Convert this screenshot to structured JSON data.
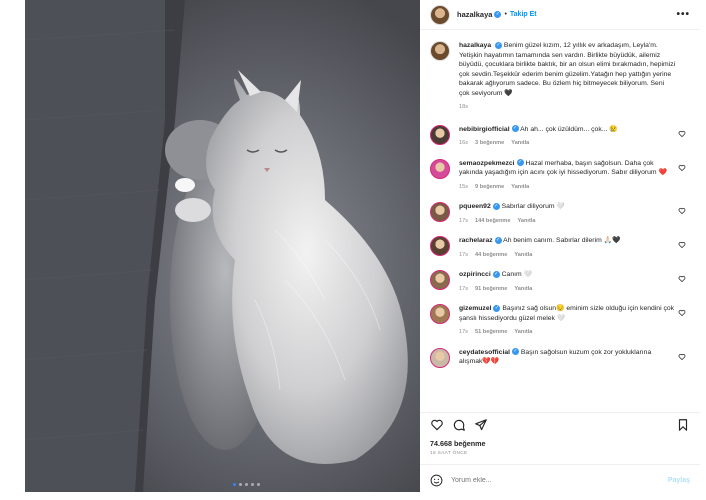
{
  "post": {
    "username": "hazalkaya",
    "follow_label": "Takip Et",
    "more_label": "•••",
    "caption": "Benim güzel kızım, 12 yıllık ev arkadaşım, Leyla'm. Yetişkin hayatımın tamamında sen vardın. Birlikte büyüdük, ailemiz büyüdü, çocuklara birlikte baktık, bir an olsun elimi bırakmadın, hepimizi çok sevdin.Teşekkür ederim benim güzelim.Yatağın hep yattığın yerine bakarak ağlıyorum sadece. Bu özlem hiç bitmeyecek biliyorum. Seni çok seviyorum 🖤",
    "caption_time": "18s"
  },
  "comments": [
    {
      "user": "nebibirgiofficial",
      "text": "Ah ah... çok üzüldüm... çok... 😢",
      "time": "16s",
      "likes": "3 beğenme",
      "reply": "Yanıtla",
      "avatar_color": "#4a3b35"
    },
    {
      "user": "semaozpekmezci",
      "text": "Hazal merhaba, başın sağolsun. Daha çok yakında yaşadığım için acını çok iyi hissediyorum. Sabır diliyorum ❤️",
      "time": "15s",
      "likes": "9 beğenme",
      "reply": "Yanıtla",
      "avatar_color": "#d64a9b"
    },
    {
      "user": "pqueen92",
      "text": "Sabırlar diliyorum 🤍",
      "time": "17s",
      "likes": "144 beğenme",
      "reply": "Yanıtla",
      "avatar_color": "#7a5a44"
    },
    {
      "user": "rachelaraz",
      "text": "Ah benim canım. Sabırlar dilerim 🙏🏻🖤",
      "time": "17s",
      "likes": "44 beğenme",
      "reply": "Yanıtla",
      "avatar_color": "#5b3f33"
    },
    {
      "user": "ozpirincci",
      "text": "Canım 🤍",
      "time": "17s",
      "likes": "91 beğenme",
      "reply": "Yanıtla",
      "avatar_color": "#8a6a4c"
    },
    {
      "user": "gizemuzel",
      "text": "Başınız sağ olsun😔 eminim sizle olduğu için kendini çok şanslı hissediyordu güzel melek 🤍",
      "time": "17s",
      "likes": "51 beğenme",
      "reply": "Yanıtla",
      "avatar_color": "#a07853"
    },
    {
      "user": "ceydatesofficial",
      "text": "Başın sağolsun kuzum çok zor yokluklarına alışmak💔💔",
      "time": "",
      "likes": "",
      "reply": "",
      "avatar_color": "#c9b9a8"
    }
  ],
  "footer": {
    "likes_count": "74.668 beğenme",
    "time_ago": "18 SAAT ÖNCE",
    "comment_placeholder": "Yorum ekle...",
    "post_label": "Paylaş"
  },
  "carousel": {
    "slides": 5,
    "active": 0
  },
  "colors": {
    "link": "#0095f6",
    "verified": "#3897f0",
    "muted": "#8e8e8e",
    "dot_active": "#3b82f6"
  },
  "icons": [
    "heart-icon",
    "comment-icon",
    "share-icon",
    "bookmark-icon",
    "emoji-icon",
    "chevron-right-icon",
    "more-icon",
    "verified-icon"
  ]
}
